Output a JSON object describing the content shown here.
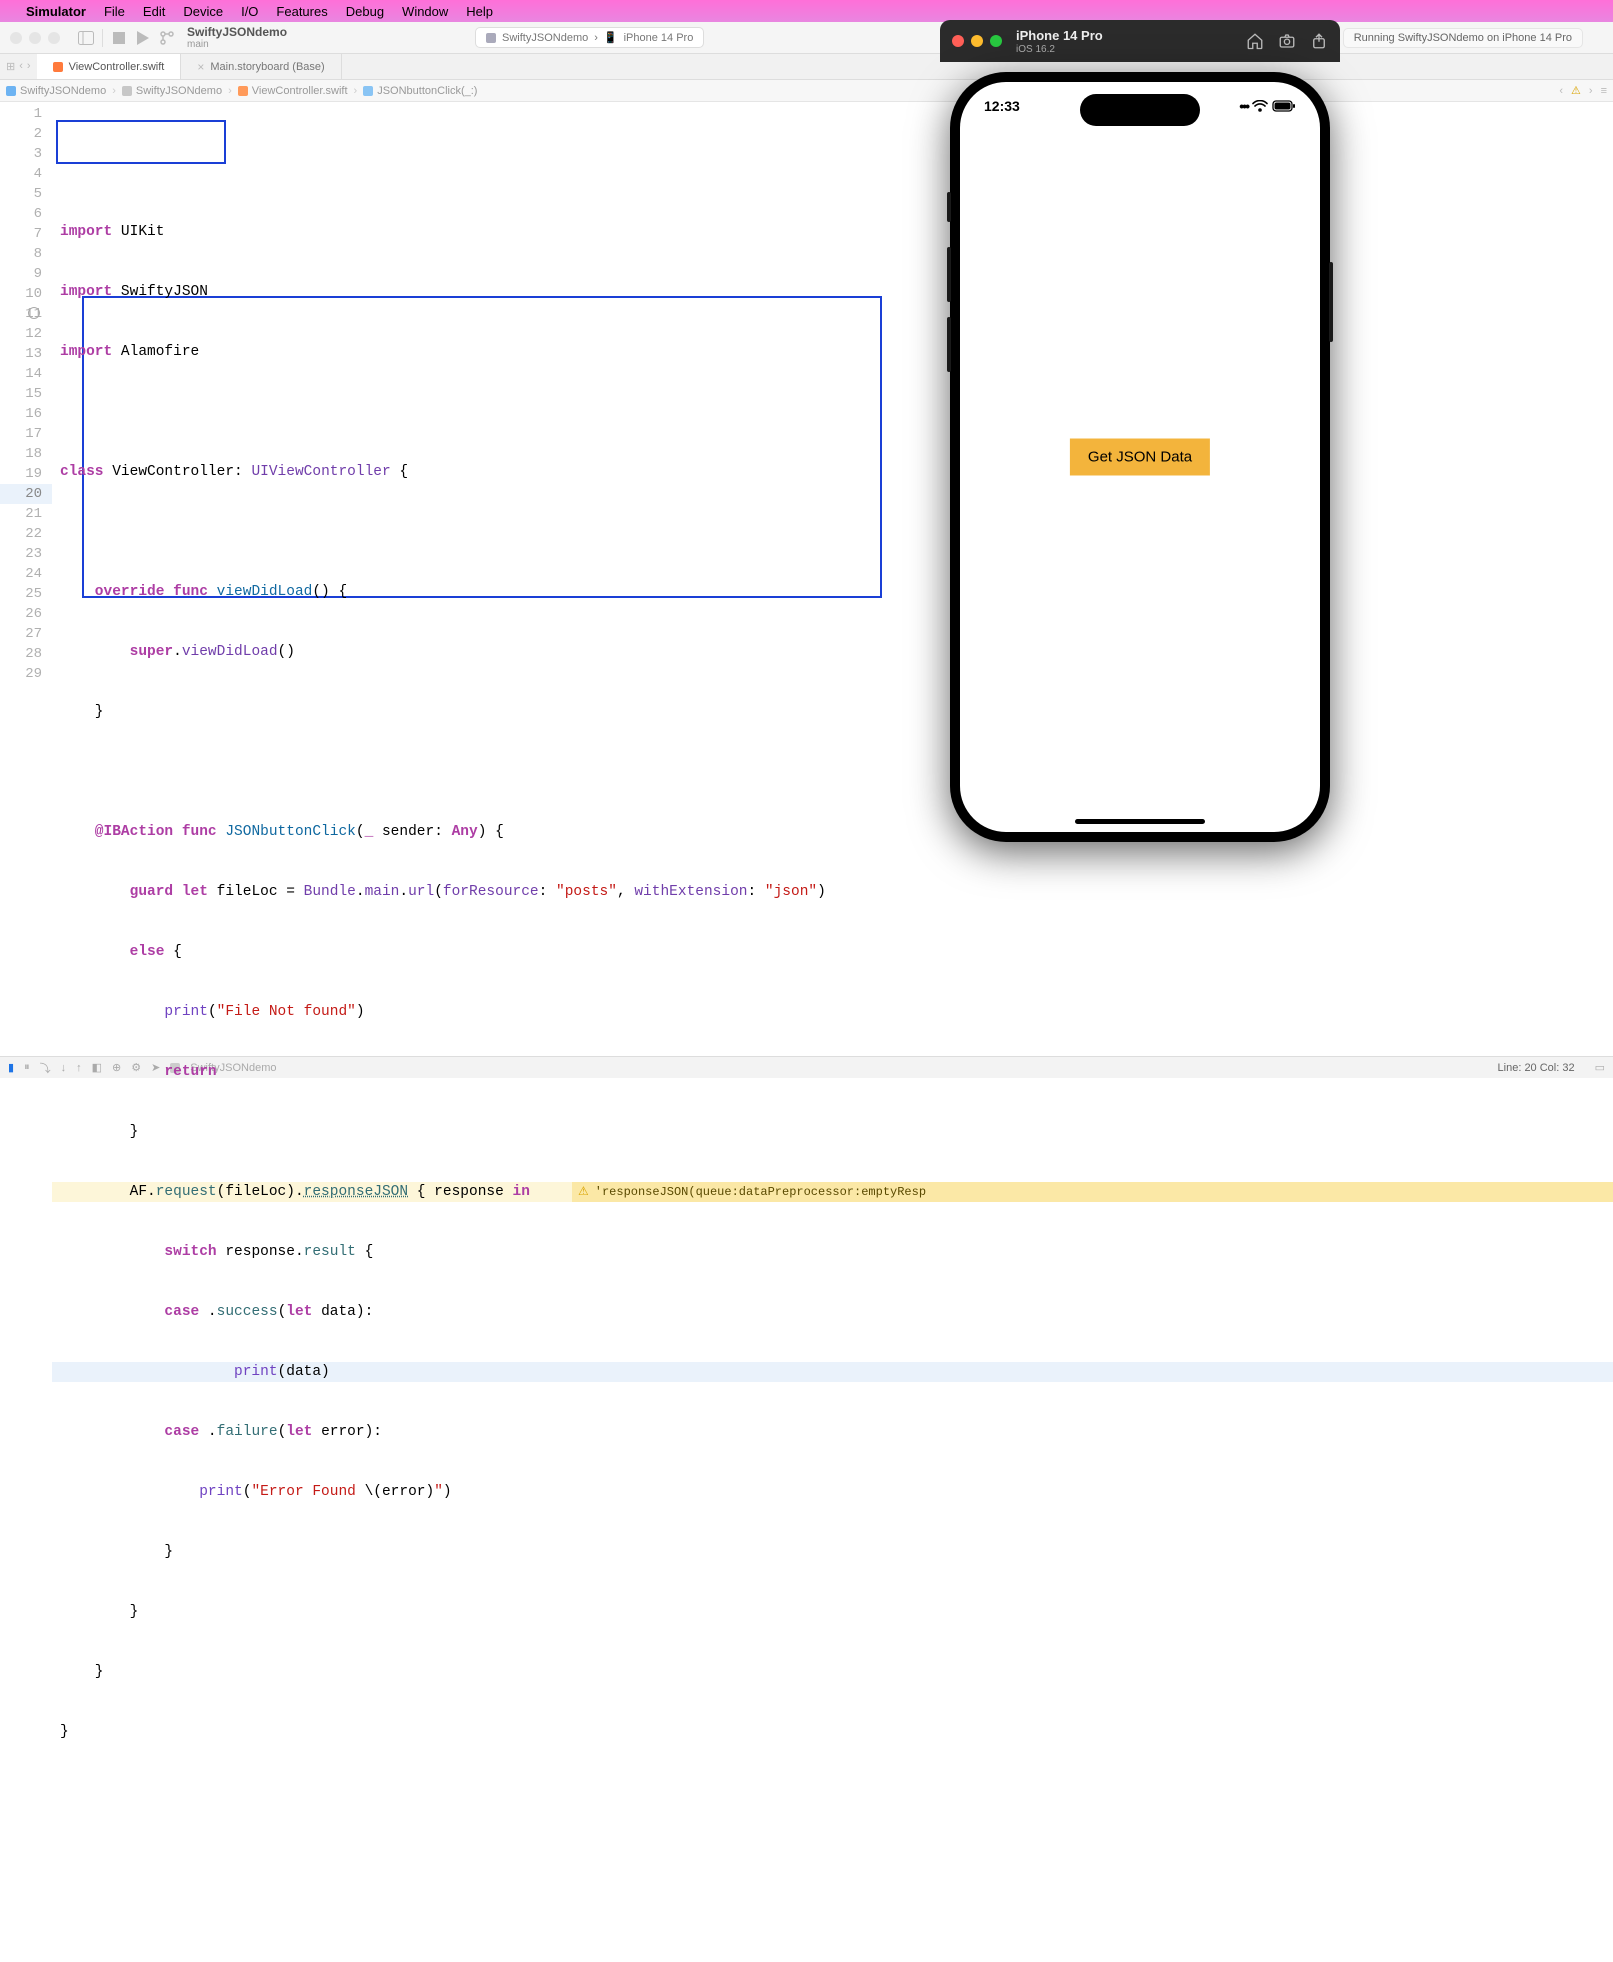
{
  "menubar": {
    "appname": "Simulator",
    "items": [
      "File",
      "Edit",
      "Device",
      "I/O",
      "Features",
      "Debug",
      "Window",
      "Help"
    ]
  },
  "xcode": {
    "scheme_title": "SwiftyJSONdemo",
    "scheme_branch": "main",
    "target_scheme": "SwiftyJSONdemo",
    "target_device": "iPhone 14 Pro",
    "status": "Running SwiftyJSONdemo on iPhone 14 Pro"
  },
  "tabs": {
    "active": "ViewController.swift",
    "other": "Main.storyboard (Base)"
  },
  "jumpbar": {
    "project": "SwiftyJSONdemo",
    "folder": "SwiftyJSONdemo",
    "file": "ViewController.swift",
    "symbol": "JSONbuttonClick(_:)"
  },
  "warning": {
    "text": "'responseJSON(queue:dataPreprocessor:emptyResp"
  },
  "footer": {
    "scheme": "SwiftyJSONdemo",
    "cursor": "Line: 20  Col: 32"
  },
  "code": {
    "l1a": "import",
    "l1b": " UIKit",
    "l2a": "import",
    "l2b": " SwiftyJSON",
    "l3a": "import",
    "l3b": " Alamofire",
    "l5a": "class",
    "l5b": " ViewController: ",
    "l5c": "UIViewController",
    "l5d": " {",
    "l7a": "    override",
    "l7b": " func",
    "l7c": " viewDidLoad",
    "l7d": "() {",
    "l8a": "        super",
    "l8b": ".",
    "l8c": "viewDidLoad",
    "l8d": "()",
    "l9": "    }",
    "l11a": "    @IBAction",
    "l11b": " func",
    "l11c": " JSONbuttonClick",
    "l11d": "(",
    "l11e": "_",
    "l11f": " sender: ",
    "l11g": "Any",
    "l11h": ") {",
    "l12a": "        guard",
    "l12b": " let",
    "l12c": " fileLoc = ",
    "l12d": "Bundle",
    "l12e": ".",
    "l12f": "main",
    "l12g": ".",
    "l12h": "url",
    "l12i": "(",
    "l12j": "forResource",
    "l12k": ": ",
    "l12l": "\"posts\"",
    "l12m": ", ",
    "l12n": "withExtension",
    "l12o": ": ",
    "l12p": "\"json\"",
    "l12q": ")",
    "l13a": "        else",
    "l13b": " {",
    "l14a": "            print",
    "l14b": "(",
    "l14c": "\"File Not found\"",
    "l14d": ")",
    "l15a": "            return",
    "l16": "        }",
    "l17a": "        AF.",
    "l17b": "request",
    "l17c": "(fileLoc).",
    "l17d": "responseJSON",
    "l17e": " { response ",
    "l17f": "in",
    "l18a": "            switch",
    "l18b": " response.",
    "l18c": "result",
    "l18d": " {",
    "l19a": "            case",
    "l19b": " .",
    "l19c": "success",
    "l19d": "(",
    "l19e": "let",
    "l19f": " data):",
    "l20a": "                    print",
    "l20b": "(data)",
    "l21a": "            case",
    "l21b": " .",
    "l21c": "failure",
    "l21d": "(",
    "l21e": "let",
    "l21f": " error):",
    "l22a": "                print",
    "l22b": "(",
    "l22c": "\"Error Found ",
    "l22d": "\\(",
    "l22e": "error",
    "l22f": ")",
    "l22g": "\"",
    "l22h": ")",
    "l23": "            }",
    "l24": "        }",
    "l25": "    }",
    "l26": "}"
  },
  "simulator": {
    "title": "iPhone 14 Pro",
    "subtitle": "iOS 16.2",
    "time": "12:33",
    "button": "Get JSON Data"
  }
}
